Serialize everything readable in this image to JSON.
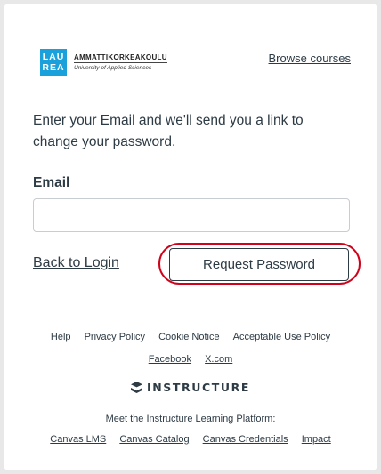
{
  "header": {
    "logo": {
      "box_line1": "LAU",
      "box_line2": "REA",
      "name": "AMMATTIKORKEAKOULU",
      "subtitle": "University of Applied Sciences",
      "color": "#1aa1db"
    },
    "browse_courses": "Browse courses"
  },
  "form": {
    "intro": "Enter your Email and we'll send you a link to change your password.",
    "email_label": "Email",
    "email_value": "",
    "email_placeholder": "",
    "back_to_login": "Back to Login",
    "request_password": "Request Password",
    "highlight_color": "#d0021b"
  },
  "footer": {
    "links_row1": [
      "Help",
      "Privacy Policy",
      "Cookie Notice",
      "Acceptable Use Policy"
    ],
    "links_row2": [
      "Facebook",
      "X.com"
    ],
    "brand": "INSTRUCTURE",
    "meet_text": "Meet the Instructure Learning Platform:",
    "links_row3": [
      "Canvas LMS",
      "Canvas Catalog",
      "Canvas Credentials",
      "Impact"
    ]
  }
}
